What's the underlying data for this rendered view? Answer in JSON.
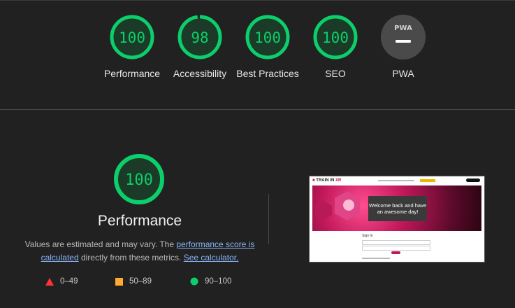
{
  "gauges": [
    {
      "score": "100",
      "label": "Performance",
      "value": 100
    },
    {
      "score": "98",
      "label": "Accessibility",
      "value": 98
    },
    {
      "score": "100",
      "label": "Best Practices",
      "value": 100
    },
    {
      "score": "100",
      "label": "SEO",
      "value": 100
    },
    {
      "score": "",
      "label": "PWA",
      "badge": "PWA"
    }
  ],
  "performance": {
    "score": "100",
    "title": "Performance",
    "desc_prefix": "Values are estimated and may vary. The ",
    "link_score": "performance score is calculated",
    "desc_middle": " directly from these metrics. ",
    "link_calc": "See calculator."
  },
  "legend": [
    {
      "label": "0–49",
      "shape": "triangle",
      "color": "#ff3333"
    },
    {
      "label": "50–89",
      "shape": "square",
      "color": "#ffaa33"
    },
    {
      "label": "90–100",
      "shape": "circle",
      "color": "#0cce6b"
    }
  ],
  "screenshot": {
    "logo_prefix": "TRAIN IN ",
    "logo_accent": "XR",
    "welcome": "Welcome back and have an awesome day!",
    "signin": "Sign In"
  },
  "colors": {
    "pass": "#0cce6b",
    "pass_fill": "#1b3a27",
    "pwa_bg": "#4a4a4a"
  }
}
